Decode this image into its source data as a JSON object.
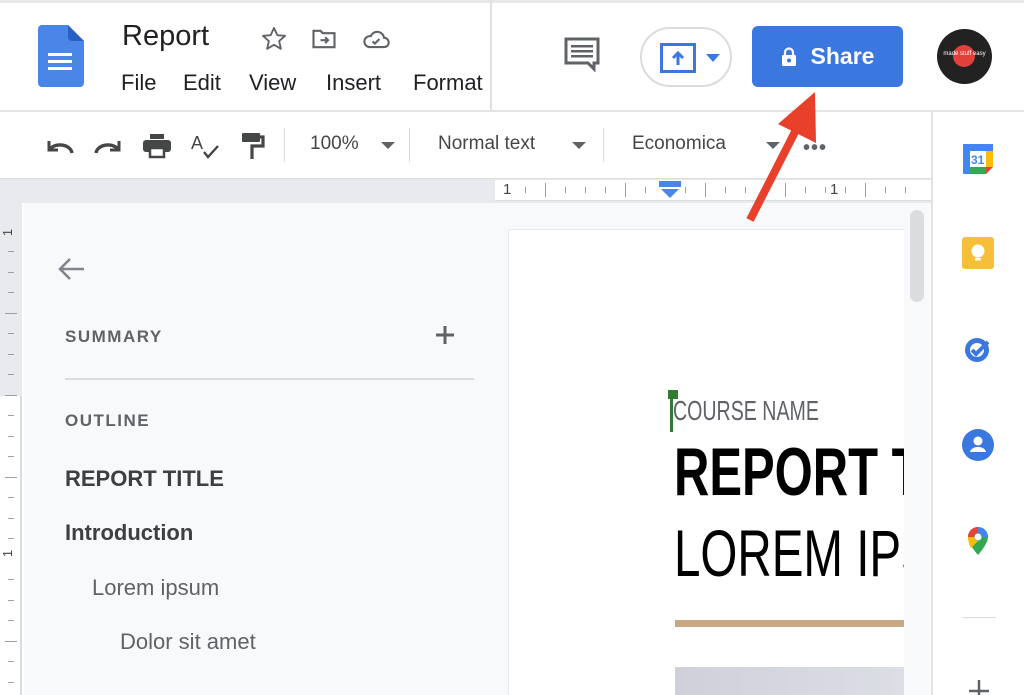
{
  "header": {
    "doc_title": "Report",
    "title_icons": [
      "star-icon",
      "move-to-folder-icon",
      "cloud-saved-icon"
    ],
    "menu": [
      "File",
      "Edit",
      "View",
      "Insert",
      "Format"
    ],
    "comment_icon": "comment-history-icon",
    "present_icon": "present-icon",
    "share_label": "Share",
    "share_icon": "lock-icon",
    "avatar_text": "made stuff easy",
    "colors": {
      "share": "#3a78e0",
      "avatar_bg": "#222222",
      "avatar_dot": "#e2403a"
    }
  },
  "toolbar": {
    "icons": [
      "undo-icon",
      "redo-icon",
      "print-icon",
      "spellcheck-icon",
      "paint-format-icon"
    ],
    "zoom": "100%",
    "style": "Normal text",
    "font": "Economica",
    "more_icon": "more-icon"
  },
  "ruler": {
    "horizontal_labels": [
      "1",
      "1"
    ],
    "vertical_labels": [
      "1",
      "1"
    ]
  },
  "outline_panel": {
    "back_icon": "back-arrow-icon",
    "summary_label": "SUMMARY",
    "add_summary_icon": "plus-icon",
    "outline_label": "OUTLINE",
    "items": [
      {
        "label": "REPORT TITLE",
        "level": 0,
        "bold": true
      },
      {
        "label": "Introduction",
        "level": 0,
        "bold": true
      },
      {
        "label": "Lorem ipsum",
        "level": 1,
        "bold": false
      },
      {
        "label": "Dolor sit amet",
        "level": 2,
        "bold": false
      }
    ]
  },
  "document": {
    "course_name": "COURSE NAME",
    "report_title": "REPORT TITLE",
    "subtitle": "LOREM IPSUM",
    "accent_rule_color": "#c8a882",
    "cursor_color": "#2e7d32"
  },
  "side_panel": {
    "apps": [
      {
        "name": "calendar",
        "label": "31"
      },
      {
        "name": "keep"
      },
      {
        "name": "tasks"
      },
      {
        "name": "contacts"
      },
      {
        "name": "maps"
      }
    ],
    "add_icon": "plus-icon"
  },
  "annotation": {
    "arrow_color": "#e8402a",
    "points_to": "share-button"
  }
}
